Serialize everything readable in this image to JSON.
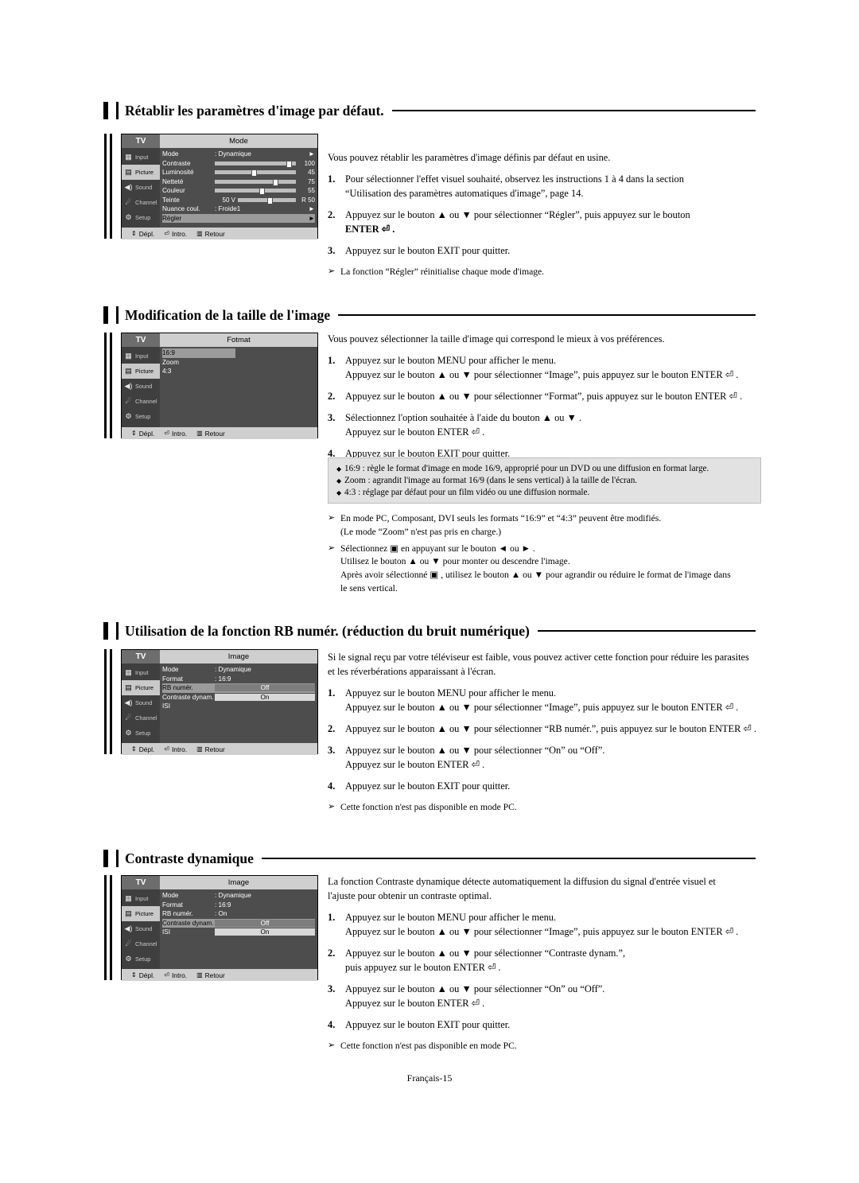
{
  "page": {
    "footer": "Français-15"
  },
  "sections": [
    {
      "title": "Rétablir les paramètres d'image par défaut.",
      "intro": "Vous pouvez rétablir les paramètres d'image définis par défaut en usine.",
      "steps": [
        {
          "num": "1.",
          "lines": [
            "Pour sélectionner l'effet visuel souhaité, observez les instructions 1 à 4 dans la section",
            "“Utilisation des paramètres automatiques d'image”, page 14."
          ]
        },
        {
          "num": "2.",
          "lines": [
            "Appuyez sur le bouton ▲ ou ▼ pour sélectionner “Régler”, puis appuyez sur le bouton",
            "ENTER ⏎ ."
          ]
        },
        {
          "num": "3.",
          "lines": [
            "Appuyez sur le bouton EXIT pour quitter."
          ]
        }
      ],
      "note": "La fonction “Régler” réinitialise chaque mode d'image."
    },
    {
      "title": "Modification de la taille de l'image",
      "intro": "Vous pouvez sélectionner la taille d'image qui correspond le mieux à vos préférences.",
      "steps": [
        {
          "num": "1.",
          "lines": [
            "Appuyez sur le bouton MENU pour afficher le menu.",
            "Appuyez sur le bouton ▲ ou ▼ pour sélectionner “Image”, puis appuyez sur le bouton ENTER ⏎ ."
          ]
        },
        {
          "num": "2.",
          "lines": [
            "Appuyez sur le bouton ▲ ou ▼ pour sélectionner “Format”, puis appuyez sur le bouton ENTER ⏎ ."
          ]
        },
        {
          "num": "3.",
          "lines": [
            "Sélectionnez l'option souhaitée à l'aide du bouton ▲ ou ▼ .",
            "Appuyez sur le bouton ENTER ⏎ ."
          ]
        },
        {
          "num": "4.",
          "lines": [
            "Appuyez sur le bouton EXIT pour quitter."
          ]
        }
      ],
      "bullets": [
        "16:9 : règle le format d'image en mode 16/9, approprié pour un DVD ou une diffusion en format large.",
        "Zoom : agrandit l'image au format 16/9 (dans le sens vertical) à la taille de l'écran.",
        "4:3 : réglage par défaut pour un film vidéo ou une diffusion normale."
      ],
      "notes": [
        [
          "En mode PC, Composant, DVI seuls les formats “16:9” et “4:3” peuvent être modifiés.",
          "(Le mode “Zoom” n'est pas pris en charge.)"
        ],
        [
          "Sélectionnez ▣ en appuyant sur le bouton ◄ ou ► .",
          "Utilisez le bouton ▲ ou ▼ pour monter ou descendre l'image.",
          "Après avoir sélectionné ▣ , utilisez le bouton ▲ ou ▼ pour agrandir ou réduire le format de l'image dans",
          "le sens vertical."
        ]
      ]
    },
    {
      "title": "Utilisation de la fonction RB numér. (réduction du bruit numérique)",
      "intro": [
        "Si le signal reçu par votre téléviseur est faible, vous pouvez activer cette fonction pour réduire les parasites",
        "et les réverbérations apparaissant à l'écran."
      ],
      "steps": [
        {
          "num": "1.",
          "lines": [
            "Appuyez sur le bouton MENU pour afficher le menu.",
            "Appuyez sur le bouton ▲ ou ▼ pour sélectionner “Image”, puis appuyez sur le bouton ENTER ⏎ ."
          ]
        },
        {
          "num": "2.",
          "lines": [
            "Appuyez sur le bouton ▲ ou ▼ pour sélectionner “RB numér.”, puis appuyez sur le bouton ENTER ⏎ ."
          ]
        },
        {
          "num": "3.",
          "lines": [
            "Appuyez sur le bouton ▲ ou ▼ pour sélectionner “On” ou “Off”.",
            "Appuyez sur le bouton ENTER ⏎ ."
          ]
        },
        {
          "num": "4.",
          "lines": [
            "Appuyez sur le bouton EXIT pour quitter."
          ]
        }
      ],
      "note": "Cette fonction n'est pas disponible en mode PC."
    },
    {
      "title": "Contraste dynamique",
      "intro": [
        "La fonction Contraste dynamique détecte automatiquement la diffusion du signal d'entrée visuel et",
        "l'ajuste pour obtenir un contraste optimal."
      ],
      "steps": [
        {
          "num": "1.",
          "lines": [
            "Appuyez sur le bouton MENU pour afficher le menu.",
            "Appuyez sur le bouton ▲ ou ▼ pour sélectionner “Image”, puis appuyez sur le bouton ENTER ⏎ ."
          ]
        },
        {
          "num": "2.",
          "lines": [
            "Appuyez sur le bouton ▲ ou ▼ pour sélectionner “Contraste dynam.”,",
            "puis appuyez sur le bouton ENTER ⏎ ."
          ]
        },
        {
          "num": "3.",
          "lines": [
            "Appuyez sur le bouton ▲ ou ▼ pour sélectionner “On” ou “Off”.",
            "Appuyez sur le bouton ENTER ⏎ ."
          ]
        },
        {
          "num": "4.",
          "lines": [
            "Appuyez sur le bouton EXIT pour quitter."
          ]
        }
      ],
      "note": "Cette fonction n'est pas disponible en mode PC."
    }
  ],
  "osd": {
    "tv_label": "TV",
    "sidebar": [
      {
        "label": "Input",
        "icon": "input-icon"
      },
      {
        "label": "Picture",
        "icon": "picture-icon"
      },
      {
        "label": "Sound",
        "icon": "sound-icon"
      },
      {
        "label": "Channel",
        "icon": "channel-icon"
      },
      {
        "label": "Setup",
        "icon": "setup-icon"
      }
    ],
    "footer": {
      "move": "Dépl.",
      "enter": "Intro.",
      "return": "Retour"
    },
    "menu1": {
      "title": "Mode",
      "rows": [
        {
          "name": "Mode",
          "value": ": Dynamique",
          "arrow": "►"
        },
        {
          "name": "Contraste",
          "value": "100",
          "bar": 88
        },
        {
          "name": "Luminosité",
          "value": "45",
          "bar": 45
        },
        {
          "name": "Netteté",
          "value": "75",
          "bar": 72
        },
        {
          "name": "Couleur",
          "value": "55",
          "bar": 55
        },
        {
          "name": "Teinte",
          "value": "50 V",
          "value2": "R 50",
          "bar": 50
        },
        {
          "name": "Nuance coul.",
          "value": ": Froide1",
          "arrow": "►"
        },
        {
          "name": "Régler",
          "value": "",
          "arrow": "►",
          "selected": true
        }
      ]
    },
    "menu2": {
      "title": "Fotmat",
      "rows": [
        {
          "name": "16:9",
          "selected": true
        },
        {
          "name": "Zoom"
        },
        {
          "name": "4:3"
        }
      ]
    },
    "menu3": {
      "title": "Image",
      "rows": [
        {
          "name": "Mode",
          "value": ": Dynamique"
        },
        {
          "name": "Format",
          "value": ": 16:9"
        },
        {
          "name": "RB numér.",
          "value": "Off",
          "selected": true,
          "toggle": true
        },
        {
          "name": "Contraste dynam.",
          "value": "On",
          "toggle": true
        },
        {
          "name": "ISI",
          "value": ""
        }
      ]
    },
    "menu4": {
      "title": "Image",
      "rows": [
        {
          "name": "Mode",
          "value": ": Dynamique"
        },
        {
          "name": "Format",
          "value": ": 16:9"
        },
        {
          "name": "RB numér.",
          "value": ": On"
        },
        {
          "name": "Contraste dynam.",
          "value": "Off",
          "selected": true,
          "toggle": true
        },
        {
          "name": "ISI",
          "value": ""
        }
      ]
    }
  }
}
